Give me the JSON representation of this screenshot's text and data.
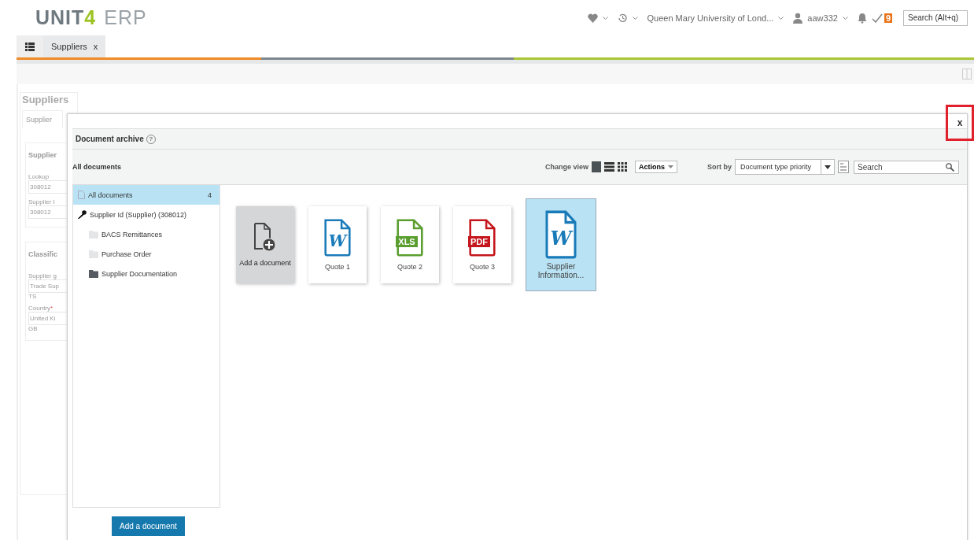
{
  "header": {
    "logo_brand": "UNIT",
    "logo_mark": "4",
    "logo_product": "ERP",
    "org": "Queen Mary University of Lond...",
    "user": "aaw332",
    "tasks_count": "9",
    "search": {
      "placeholder": "Search (Alt+q)"
    }
  },
  "tabs": [
    {
      "label": "Suppliers",
      "close": "x",
      "selected": true
    }
  ],
  "background_form": {
    "title": "Suppliers",
    "tab": "Supplier",
    "sections": [
      {
        "title": "Supplier",
        "fields": [
          {
            "label": "Lookup",
            "value": "308012"
          },
          {
            "label": "Supplier I",
            "value": "308012"
          }
        ]
      },
      {
        "title": "Classific",
        "fields": [
          {
            "label": "Supplier g",
            "value": "Trade Sup",
            "code": "TS"
          },
          {
            "label": "Country",
            "value": "United Ki",
            "code": "GB",
            "required_mark": "*"
          }
        ]
      }
    ]
  },
  "modal": {
    "title": "Document archive",
    "help": "?",
    "close": "x",
    "breadcrumb": "All documents",
    "change_view_label": "Change view",
    "views": [
      {
        "kind": "tiles",
        "selected": true
      },
      {
        "kind": "list",
        "selected": false
      },
      {
        "kind": "grid",
        "selected": false
      }
    ],
    "actions": "Actions",
    "sort_label": "Sort by",
    "sort_value": "Document type priority",
    "search_placeholder": "Search",
    "tree": [
      {
        "kind": "all",
        "label": "All documents",
        "count": "4",
        "selected": true
      },
      {
        "kind": "key",
        "label": "Supplier Id (Supplier) (308012)",
        "selected": false,
        "children": [
          {
            "kind": "folder",
            "label": "BACS Remittances",
            "has_files": false,
            "selected": false
          },
          {
            "kind": "folder",
            "label": "Purchase Order",
            "has_files": false,
            "selected": false
          },
          {
            "kind": "folder",
            "label": "Supplier Documentation",
            "has_files": true,
            "selected": false
          }
        ]
      }
    ],
    "documents": [
      {
        "kind": "add",
        "label": "Add a document",
        "selected": false
      },
      {
        "kind": "word",
        "badge": "W",
        "label": "Quote 1",
        "selected": false
      },
      {
        "kind": "excel",
        "badge": "XLS",
        "label": "Quote 2",
        "selected": false
      },
      {
        "kind": "pdf",
        "badge": "PDF",
        "label": "Quote 3",
        "selected": false
      },
      {
        "kind": "word",
        "badge": "W",
        "label": "Supplier Information...",
        "selected": true
      }
    ],
    "footer_button": "Add a document"
  }
}
